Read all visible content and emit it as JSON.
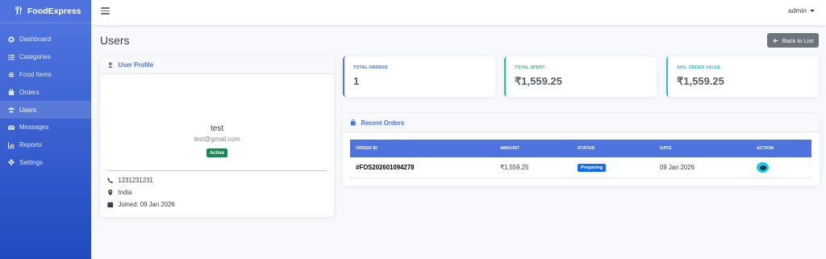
{
  "brand": {
    "name": "FoodExpress",
    "icon": "utensils-icon"
  },
  "sidebar": {
    "items": [
      {
        "label": "Dashboard",
        "icon": "dashboard-icon",
        "active": false
      },
      {
        "label": "Categories",
        "icon": "list-icon",
        "active": false
      },
      {
        "label": "Food Items",
        "icon": "hamburger-food-icon",
        "active": false
      },
      {
        "label": "Orders",
        "icon": "shopping-bag-icon",
        "active": false
      },
      {
        "label": "Users",
        "icon": "users-icon",
        "active": true
      },
      {
        "label": "Messages",
        "icon": "envelope-icon",
        "active": false
      },
      {
        "label": "Reports",
        "icon": "chart-icon",
        "active": false
      },
      {
        "label": "Settings",
        "icon": "gear-icon",
        "active": false
      }
    ]
  },
  "topbar": {
    "user": "admin"
  },
  "page": {
    "title": "Users",
    "back_label": "Back to List"
  },
  "profile": {
    "header": "User Profile",
    "name": "test",
    "email": "test@gmail.com",
    "status": "Active",
    "phone": "1231231231",
    "location": "India",
    "joined": "Joined: 09 Jan 2026"
  },
  "stats": {
    "total_orders": {
      "label": "TOTAL ORDERS",
      "value": "1"
    },
    "total_spent": {
      "label": "TOTAL SPENT",
      "value": "₹1,559.25"
    },
    "avg_order": {
      "label": "AVG. ORDER VALUE",
      "value": "₹1,559.25"
    }
  },
  "orders": {
    "header": "Recent Orders",
    "columns": {
      "id": "ORDER ID",
      "amount": "AMOUNT",
      "status": "STATUS",
      "date": "DATE",
      "action": "ACTION"
    },
    "rows": [
      {
        "id": "#FOS202601094278",
        "amount": "₹1,559.25",
        "status": "Preparing",
        "date": "09 Jan 2026"
      }
    ]
  },
  "colors": {
    "primary": "#4e73df",
    "success": "#1cc88a",
    "info": "#36b9cc",
    "secondary": "#6c757d"
  }
}
